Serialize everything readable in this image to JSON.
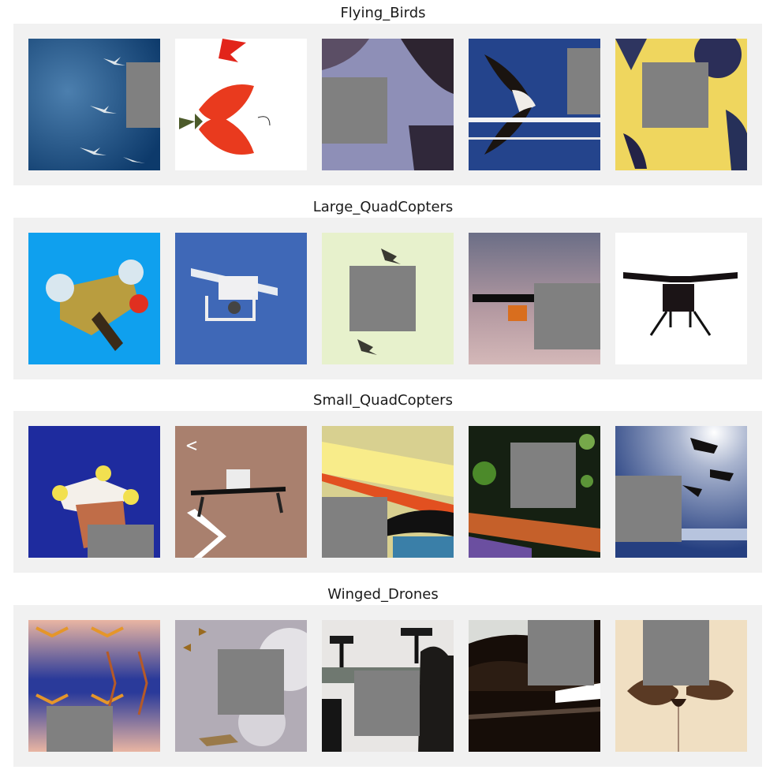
{
  "sections": [
    {
      "title": "Flying_Birds"
    },
    {
      "title": "Large_QuadCopters"
    },
    {
      "title": "Small_QuadCopters"
    },
    {
      "title": "Winged_Drones"
    }
  ],
  "colors": {
    "band_background": "#f1f1f1",
    "occlusion_mask": "#808080"
  }
}
